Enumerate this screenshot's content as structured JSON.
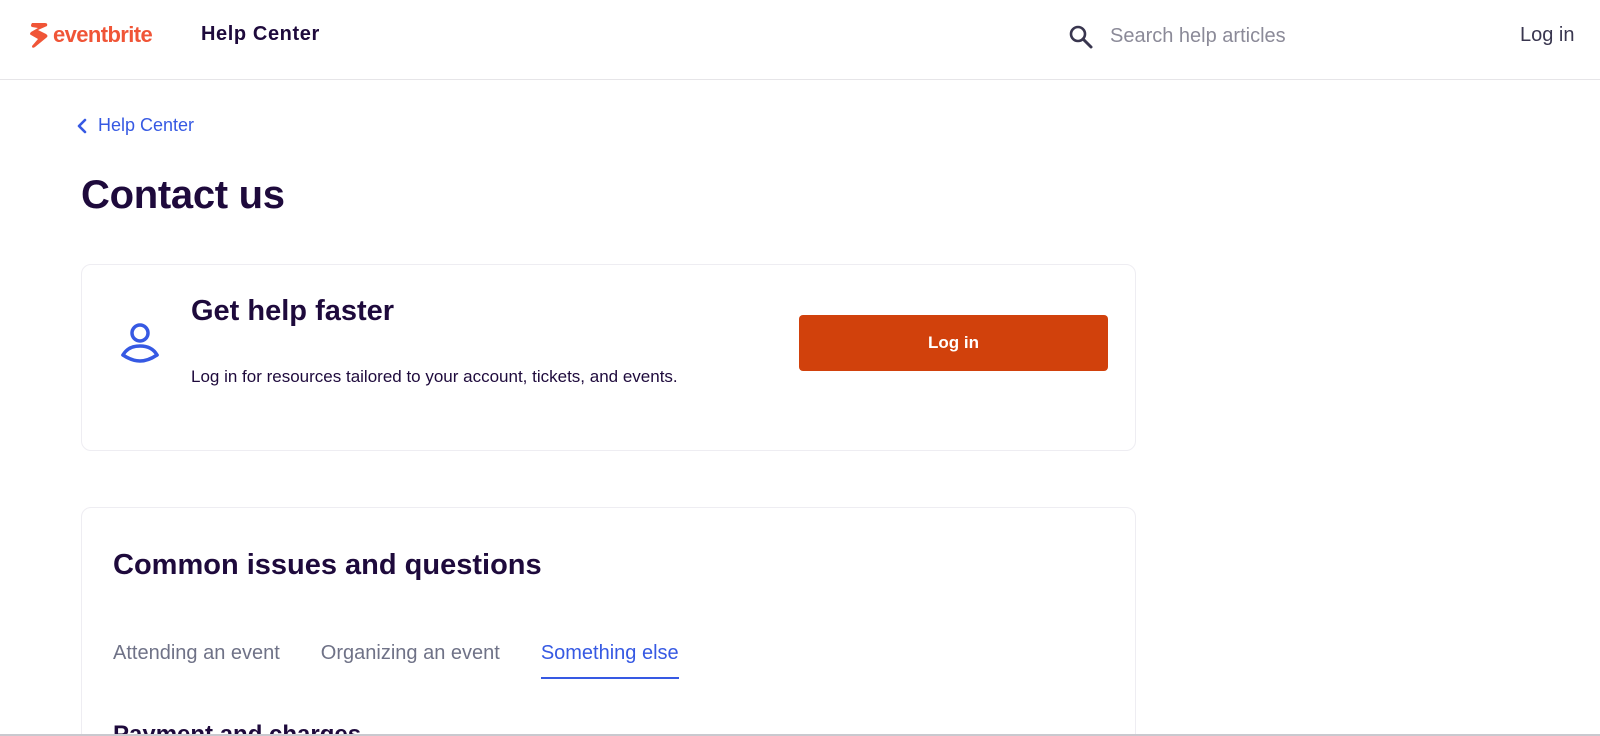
{
  "header": {
    "logo_text": "eventbrite",
    "title": "Help Center",
    "search_placeholder": "Search help articles",
    "login_label": "Log in"
  },
  "breadcrumb": {
    "label": "Help Center"
  },
  "page_title": "Contact us",
  "help_card": {
    "title": "Get help faster",
    "description": "Log in for resources tailored to your account, tickets, and events.",
    "button_label": "Log in"
  },
  "issues": {
    "title": "Common issues and questions",
    "tabs": [
      {
        "label": "Attending an event",
        "active": false
      },
      {
        "label": "Organizing an event",
        "active": false
      },
      {
        "label": "Something else",
        "active": true
      }
    ],
    "section_heading": "Payment and charges"
  },
  "colors": {
    "brand": "#f05537",
    "primary_button": "#d1410c",
    "link": "#3659e3",
    "text": "#1e0a3c"
  },
  "icons": {
    "logo": "eventbrite-logo-icon",
    "search": "search-icon",
    "back": "chevron-left-icon",
    "person": "person-icon"
  }
}
